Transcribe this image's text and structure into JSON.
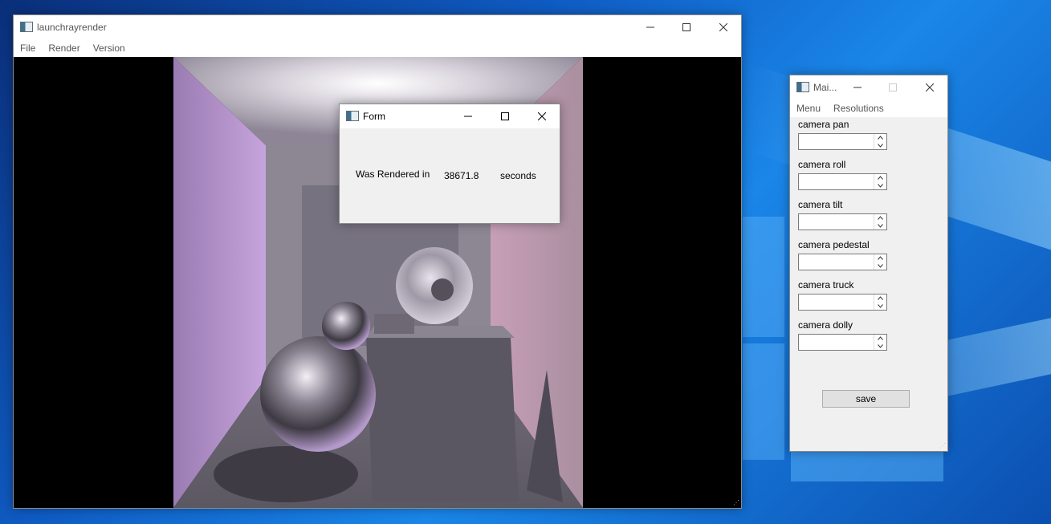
{
  "main_window": {
    "title": "launchrayrender",
    "menu": [
      "File",
      "Render",
      "Version"
    ]
  },
  "form_dialog": {
    "title": "Form",
    "label": "Was Rendered in",
    "value": "38671.8",
    "unit": "seconds"
  },
  "side_window": {
    "title": "Mai...",
    "menu": [
      "Menu",
      "Resolutions"
    ],
    "fields": [
      {
        "label": "camera pan",
        "value": ""
      },
      {
        "label": "camera roll",
        "value": ""
      },
      {
        "label": "camera tilt",
        "value": ""
      },
      {
        "label": "camera pedestal",
        "value": ""
      },
      {
        "label": "camera truck",
        "value": ""
      },
      {
        "label": "camera dolly",
        "value": ""
      }
    ],
    "save_label": "save"
  },
  "icons": {
    "app": "app-window-icon",
    "minimize": "minimize-icon",
    "maximize": "maximize-icon",
    "close": "close-icon",
    "spin_up": "chevron-up-icon",
    "spin_down": "chevron-down-icon",
    "resize": "resize-grip-icon"
  },
  "colors": {
    "desktop": "#0f5bc2",
    "window_bg": "#f0f0f0",
    "button_bg": "#e1e1e1"
  }
}
